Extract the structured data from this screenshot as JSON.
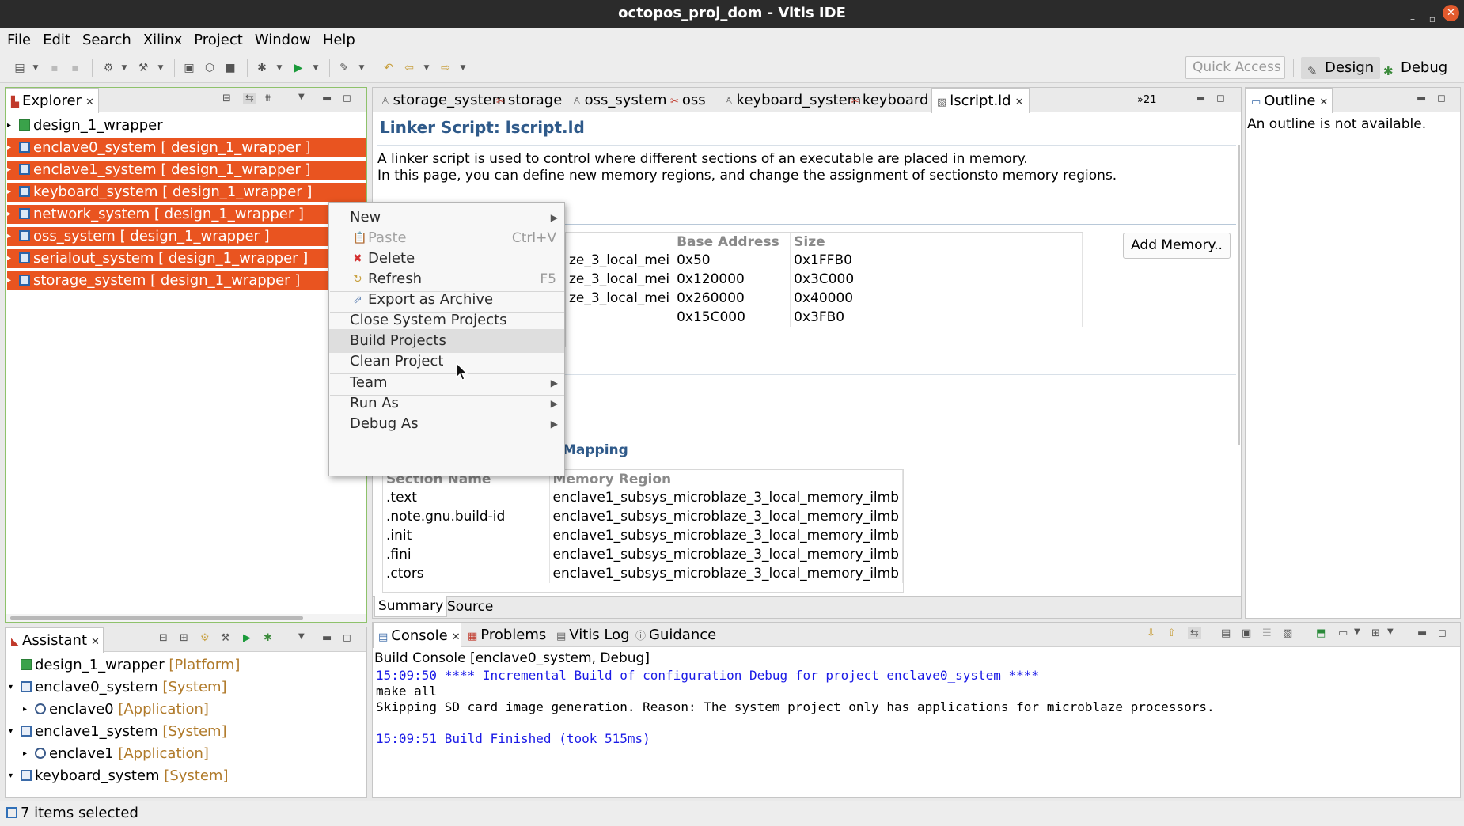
{
  "window": {
    "title": "octopos_proj_dom - Vitis IDE",
    "minimize": "–",
    "maximize": "▫",
    "close": "✕"
  },
  "menubar": [
    "File",
    "Edit",
    "Search",
    "Xilinx",
    "Project",
    "Window",
    "Help"
  ],
  "toolbar": {
    "quick_access_placeholder": "Quick Access",
    "perspectives": [
      {
        "label": "Design",
        "icon": "design-perspective-icon"
      },
      {
        "label": "Debug",
        "icon": "debug-perspective-icon"
      }
    ]
  },
  "explorer": {
    "tab_label": "Explorer",
    "items": [
      {
        "label": "design_1_wrapper",
        "selected": false,
        "icon": "platform-icon"
      },
      {
        "label": "enclave0_system [ design_1_wrapper ]",
        "selected": true,
        "icon": "system-project-icon"
      },
      {
        "label": "enclave1_system [ design_1_wrapper ]",
        "selected": true,
        "icon": "system-project-icon"
      },
      {
        "label": "keyboard_system [ design_1_wrapper ]",
        "selected": true,
        "icon": "system-project-icon"
      },
      {
        "label": "network_system [ design_1_wrapper ]",
        "selected": true,
        "icon": "system-project-icon"
      },
      {
        "label": "oss_system [ design_1_wrapper ]",
        "selected": true,
        "icon": "system-project-icon"
      },
      {
        "label": "serialout_system [ design_1_wrapper ]",
        "selected": true,
        "icon": "system-project-icon"
      },
      {
        "label": "storage_system [ design_1_wrapper ]",
        "selected": true,
        "icon": "system-project-icon"
      }
    ]
  },
  "editor_tabs": [
    {
      "label": "storage_system",
      "icon": "system-icon"
    },
    {
      "label": "storage",
      "icon": "app-icon"
    },
    {
      "label": "oss_system",
      "icon": "system-icon"
    },
    {
      "label": "oss",
      "icon": "app-icon"
    },
    {
      "label": "keyboard_system",
      "icon": "system-icon"
    },
    {
      "label": "keyboard",
      "icon": "app-icon"
    },
    {
      "label": "lscript.ld",
      "icon": "linker-icon",
      "active": true
    }
  ],
  "editor_overflow": "»21",
  "editor": {
    "title": "Linker Script: lscript.ld",
    "desc_line1": "A linker script is used to control where different sections of an executable are placed in memory.",
    "desc_line2": "In this page, you can define new memory regions, and change the assignment of sectionsto memory regions.",
    "memory_table": {
      "headers": [
        "Base Address",
        "Size"
      ],
      "rows": [
        {
          "name": "ze_3_local_mei",
          "base": "0x50",
          "size": "0x1FFB0"
        },
        {
          "name": "ze_3_local_mei",
          "base": "0x120000",
          "size": "0x3C000"
        },
        {
          "name": "ze_3_local_mei",
          "base": "0x260000",
          "size": "0x40000"
        },
        {
          "name": "",
          "base": "0x15C000",
          "size": "0x3FB0"
        }
      ]
    },
    "add_memory_button": "Add Memory..",
    "mapping_heading": "Mapping",
    "section_table": {
      "headers": [
        "Section Name",
        "Memory Region"
      ],
      "rows": [
        {
          "section": ".text",
          "region": "enclave1_subsys_microblaze_3_local_memory_ilmb"
        },
        {
          "section": ".note.gnu.build-id",
          "region": "enclave1_subsys_microblaze_3_local_memory_ilmb"
        },
        {
          "section": ".init",
          "region": "enclave1_subsys_microblaze_3_local_memory_ilmb"
        },
        {
          "section": ".fini",
          "region": "enclave1_subsys_microblaze_3_local_memory_ilmb"
        },
        {
          "section": ".ctors",
          "region": "enclave1_subsys_microblaze_3_local_memory_ilmb"
        }
      ]
    },
    "bottom_tabs": [
      "Summary",
      "Source"
    ]
  },
  "outline": {
    "tab_label": "Outline",
    "message": "An outline is not available."
  },
  "context_menu": [
    {
      "label": "New",
      "submenu": true
    },
    {
      "label": "Paste",
      "shortcut": "Ctrl+V",
      "disabled": true,
      "icon": "paste-icon"
    },
    {
      "label": "Delete",
      "icon": "delete-icon"
    },
    {
      "label": "Refresh",
      "shortcut": "F5",
      "icon": "refresh-icon"
    },
    {
      "label": "Export as Archive",
      "icon": "export-icon"
    },
    {
      "label": "Close System Projects"
    },
    {
      "label": "Build Projects",
      "highlighted": true
    },
    {
      "label": "Clean Project"
    },
    {
      "label": "Team",
      "submenu": true
    },
    {
      "label": "Run As",
      "submenu": true
    },
    {
      "label": "Debug As",
      "submenu": true
    }
  ],
  "assistant": {
    "tab_label": "Assistant",
    "items": [
      {
        "name": "design_1_wrapper",
        "tag": "[Platform]"
      },
      {
        "name": "enclave0_system",
        "tag": "[System]"
      },
      {
        "name": "enclave0",
        "tag": "[Application]"
      },
      {
        "name": "enclave1_system",
        "tag": "[System]"
      },
      {
        "name": "enclave1",
        "tag": "[Application]"
      },
      {
        "name": "keyboard_system",
        "tag": "[System]"
      }
    ]
  },
  "console": {
    "tabs": [
      "Console",
      "Problems",
      "Vitis Log",
      "Guidance"
    ],
    "header": "Build Console [enclave0_system, Debug]",
    "lines": [
      {
        "text": "15:09:50 **** Incremental Build of configuration Debug for project enclave0_system ****",
        "color": "#1a1ae6"
      },
      {
        "text": "make all",
        "color": "#000000"
      },
      {
        "text": "Skipping SD card image generation. Reason: The system project only has applications for microblaze processors.",
        "color": "#000000"
      },
      {
        "text": "",
        "color": "#000000"
      },
      {
        "text": "15:09:51 Build Finished (took 515ms)",
        "color": "#1a1ae6"
      }
    ]
  },
  "status": {
    "text": "7 items selected"
  },
  "colors": {
    "selection": "#e95420",
    "link_blue": "#1a1ae6",
    "tag_brown": "#b07a2a",
    "title_blue": "#2f5a8a"
  }
}
